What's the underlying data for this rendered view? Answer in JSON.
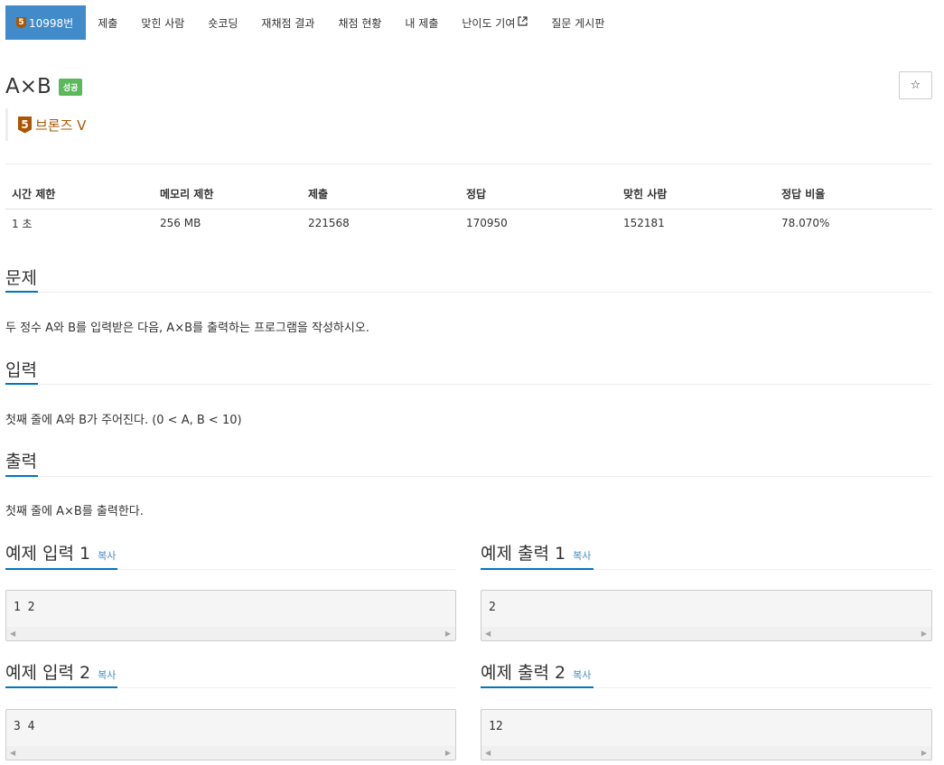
{
  "nav": {
    "tabs": [
      {
        "label": "10998번",
        "tier": "5"
      },
      {
        "label": "제출"
      },
      {
        "label": "맞힌 사람"
      },
      {
        "label": "숏코딩"
      },
      {
        "label": "재채점 결과"
      },
      {
        "label": "채점 현황"
      },
      {
        "label": "내 제출"
      },
      {
        "label": "난이도 기여"
      },
      {
        "label": "질문 게시판"
      }
    ]
  },
  "problem": {
    "title": "A×B",
    "status_badge": "성공",
    "star_icon": "☆",
    "tier_number": "5",
    "tier_name": "브론즈 V"
  },
  "info": {
    "headers": [
      "시간 제한",
      "메모리 제한",
      "제출",
      "정답",
      "맞힌 사람",
      "정답 비율"
    ],
    "values": [
      "1 초",
      "256 MB",
      "221568",
      "170950",
      "152181",
      "78.070%"
    ]
  },
  "sections": {
    "problem_heading": "문제",
    "problem_text": "두 정수 A와 B를 입력받은 다음, A×B를 출력하는 프로그램을 작성하시오.",
    "input_heading": "입력",
    "input_text": "첫째 줄에 A와 B가 주어진다. (0 < A, B < 10)",
    "output_heading": "출력",
    "output_text": "첫째 줄에 A×B를 출력한다."
  },
  "samples": {
    "copy_label": "복사",
    "input1_title": "예제 입력 1",
    "input1_value": "1 2",
    "output1_title": "예제 출력 1",
    "output1_value": "2",
    "input2_title": "예제 입력 2",
    "input2_value": "3 4",
    "output2_title": "예제 출력 2",
    "output2_value": "12"
  },
  "colors": {
    "nav_active": "#428bca",
    "success": "#5cb85c",
    "bronze": "#ad5600",
    "accent": "#0076c0"
  }
}
